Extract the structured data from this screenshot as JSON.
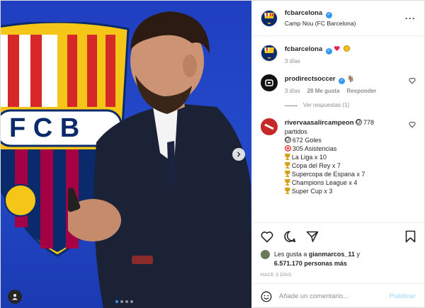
{
  "header": {
    "username": "fcbarcelona",
    "location": "Camp Nou (FC Barcelona)",
    "more_label": "···"
  },
  "media": {
    "current_slide": 1,
    "total_slides": 4
  },
  "comments": [
    {
      "username": "fcbarcelona",
      "emojis": [
        "heart",
        "face"
      ],
      "meta_time": "3 días"
    },
    {
      "username": "prodirectsoccer",
      "text_suffix": "🐐",
      "meta_time": "3 días",
      "meta_likes": "28 Me gusta",
      "meta_reply": "Responder",
      "view_replies": "Ver respuestas (1)"
    },
    {
      "username": "rivervaasalircampeon",
      "first_line": "778",
      "second_line": "partidos",
      "stats": [
        {
          "icon": "ball",
          "text": "672 Goles"
        },
        {
          "icon": "target",
          "text": "305 Asistencias"
        },
        {
          "icon": "trophy",
          "text": "La Liga x 10"
        },
        {
          "icon": "trophy",
          "text": "Copa del Rey x 7"
        },
        {
          "icon": "trophy",
          "text": "Supercopa de Espana x 7"
        },
        {
          "icon": "trophy",
          "text": "Champions League x 4"
        },
        {
          "icon": "trophy",
          "text": "Super Cup x 3"
        }
      ]
    }
  ],
  "likes": {
    "prefix": "Les gusta a",
    "liker": "gianmarcos_11",
    "conj": "y",
    "count": "6.571.170 personas más"
  },
  "time_ago": "HACE 3 DÍAS",
  "composer": {
    "placeholder": "Añade un comentario...",
    "publish_label": "Publicar"
  },
  "colors": {
    "verified": "#3897f0",
    "publish_disabled": "#b2dffc",
    "media_bg": "#1f3fc0"
  }
}
